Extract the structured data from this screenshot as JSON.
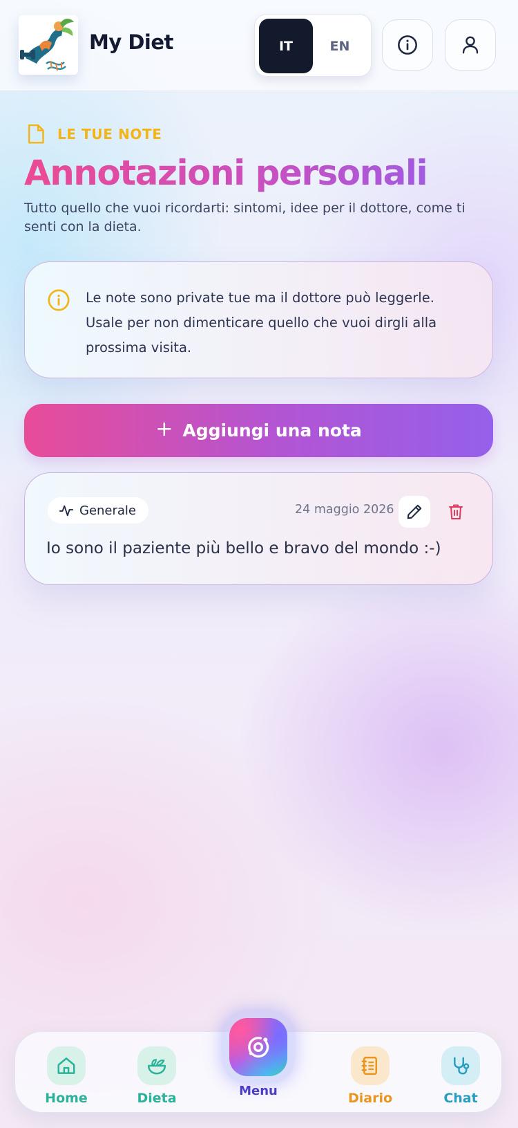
{
  "header": {
    "app_name": "My Diet",
    "languages": [
      {
        "code": "IT",
        "active": true
      },
      {
        "code": "EN",
        "active": false
      }
    ]
  },
  "page": {
    "eyebrow": "LE TUE NOTE",
    "title": "Annotazioni personali",
    "subtitle": "Tutto quello che vuoi ricordarti: sintomi, idee per il dottore, come ti senti con la dieta."
  },
  "info_card": {
    "text": "Le note sono private tue ma il dottore può leggerle. Usale per non dimenticare quello che vuoi dirgli alla prossima visita."
  },
  "add_button": {
    "label": "Aggiungi una nota"
  },
  "notes": [
    {
      "category": "Generale",
      "date": "24 maggio 2026",
      "text": "Io sono il paziente più bello e bravo del mondo :-)"
    }
  ],
  "bottom_nav": {
    "items": [
      {
        "label": "Home",
        "color": "#2bb29a"
      },
      {
        "label": "Dieta",
        "color": "#2bb29a"
      },
      {
        "label": "Menu",
        "color": "#4a3fc6"
      },
      {
        "label": "Diario",
        "color": "#e8961e"
      },
      {
        "label": "Chat",
        "color": "#2a9ec0"
      }
    ]
  },
  "colors": {
    "accent_pink": "#ec4a93",
    "accent_purple": "#9560ea",
    "eyebrow_yellow": "#f2b418",
    "dark": "#121a2c",
    "delete_red": "#e23a5c"
  }
}
